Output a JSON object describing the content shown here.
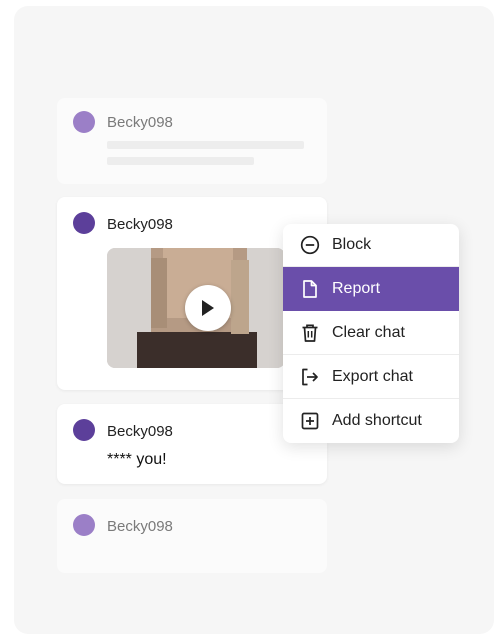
{
  "colors": {
    "accent": "#6a4eaa",
    "avatar_faded": "#9b7fc7",
    "avatar_active": "#5c3f9a"
  },
  "messages": [
    {
      "username": "Becky098",
      "state": "faded",
      "content": "skeleton-lines"
    },
    {
      "username": "Becky098",
      "state": "active",
      "content": "video",
      "video_play_icon": "play-icon"
    },
    {
      "username": "Becky098",
      "state": "active",
      "text": "**** you!"
    },
    {
      "username": "Becky098",
      "state": "faded"
    }
  ],
  "context_menu": {
    "items": [
      {
        "label": "Block",
        "icon": "block-icon"
      },
      {
        "label": "Report",
        "icon": "report-icon",
        "selected": true
      },
      {
        "label": "Clear chat",
        "icon": "trash-icon"
      },
      {
        "label": "Export chat",
        "icon": "export-icon"
      },
      {
        "label": "Add shortcut",
        "icon": "add-shortcut-icon"
      }
    ]
  }
}
